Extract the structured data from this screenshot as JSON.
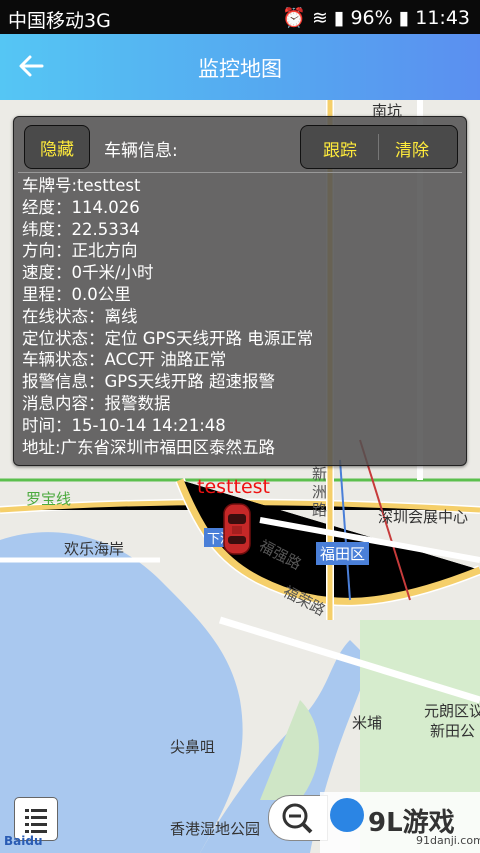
{
  "status_bar": {
    "carrier": "中国移动3G",
    "network": "3G",
    "battery": "96%",
    "time": "11:43"
  },
  "header": {
    "title": "监控地图"
  },
  "panel": {
    "hide_label": "隐藏",
    "vehicle_info_label": "车辆信息:",
    "track_label": "跟踪",
    "clear_label": "清除",
    "lines": [
      "车牌号:testtest",
      "经度：114.026",
      "纬度：22.5334",
      "方向：正北方向",
      "速度：0千米/小时",
      "里程：0.0公里",
      "在线状态：离线",
      "定位状态：定位 GPS天线开路 电源正常",
      "车辆状态：ACC开 油路正常",
      "报警信息：GPS天线开路 超速报警",
      "消息内容：报警数据",
      "时间：15-10-14 14:21:48",
      "地址:广东省深圳市福田区泰然五路"
    ]
  },
  "map": {
    "labels": {
      "luobao": "罗宝线",
      "huanle": "欢乐海岸",
      "xinzhou": "新洲路",
      "huizhan": "深圳会展中心",
      "futian": "福田区",
      "fuqiang": "福强路",
      "fuhua": "福荣路",
      "fuhua_bei": "福田",
      "tianhan": "尖鼻咀",
      "mipu": "米埔",
      "yuanlang": "元朗区议",
      "xintian": "新田公",
      "xianggang": "香港湿地公园",
      "xia": "下沙",
      "nan": "南坑"
    },
    "car_label": "testtest",
    "baidu": "Baidu"
  },
  "watermark": {
    "logo": "9L游戏",
    "url": "91danji.com"
  }
}
